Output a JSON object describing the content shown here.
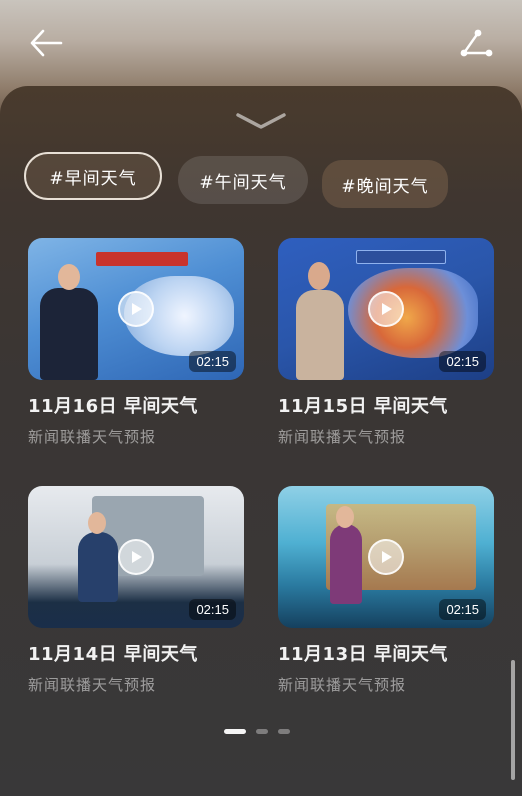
{
  "topbar": {
    "back_icon": "arrow-left-icon",
    "share_icon": "share-icon"
  },
  "panel": {
    "handle_icon": "chevron-down-icon"
  },
  "chips": [
    {
      "label": "#早间天气",
      "active": true
    },
    {
      "label": "#午间天气",
      "active": false
    },
    {
      "label": "#晚间天气",
      "active": false
    }
  ],
  "videos": [
    {
      "title": "11月16日 早间天气",
      "subtitle": "新闻联播天气预报",
      "duration": "02:15"
    },
    {
      "title": "11月15日 早间天气",
      "subtitle": "新闻联播天气预报",
      "duration": "02:15"
    },
    {
      "title": "11月14日 早间天气",
      "subtitle": "新闻联播天气预报",
      "duration": "02:15"
    },
    {
      "title": "11月13日 早间天气",
      "subtitle": "新闻联播天气预报",
      "duration": "02:15"
    }
  ],
  "pagination": {
    "pages": 3,
    "current": 1
  },
  "colors": {
    "accent_chip_border": "#e8e0d6",
    "panel_bg": "#3a3634"
  }
}
